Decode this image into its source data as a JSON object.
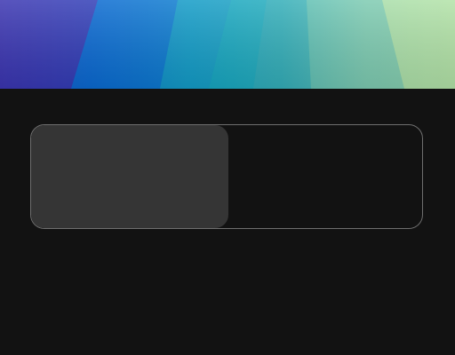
{
  "banner": {
    "image_name": "abstract-gradient-wallpaper",
    "colors": [
      "#3b3bb8",
      "#0f6fd0",
      "#10a8c4",
      "#5fc6b6",
      "#b4e3a6"
    ]
  },
  "toggle": {
    "selected_index": 0,
    "options": [
      {
        "label": "",
        "active": true
      },
      {
        "label": "",
        "active": false
      }
    ],
    "colors": {
      "background": "#121212",
      "border": "#6f6f6f",
      "active_segment": "#353535"
    }
  }
}
